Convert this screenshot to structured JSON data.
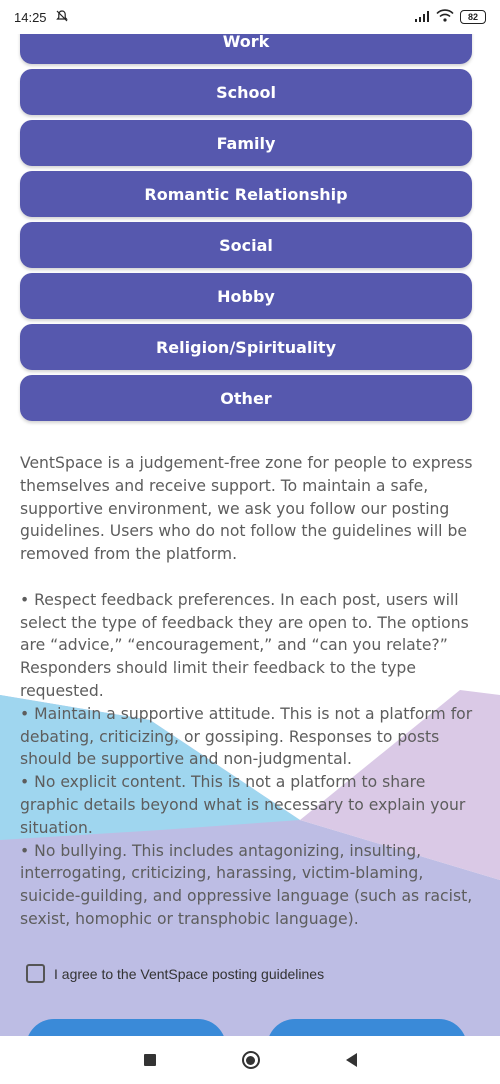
{
  "status_bar": {
    "time": "14:25",
    "battery": "82"
  },
  "categories": [
    "Work",
    "School",
    "Family",
    "Romantic Relationship",
    "Social",
    "Hobby",
    "Religion/Spirituality",
    "Other"
  ],
  "guidelines": {
    "intro": "VentSpace is a judgement-free zone for people to express themselves and receive support. To maintain a safe, supportive environment, we ask you follow our posting guidelines. Users who do not follow the guidelines will be removed from the platform.",
    "rules": [
      "• Respect feedback preferences. In each post, users will select the type of feedback they are open to. The options are “advice,” “encouragement,” and “can you relate?” Responders should limit their feedback to the type requested.",
      "• Maintain a supportive attitude. This is not a platform for debating, criticizing, or gossiping. Responses to posts should be supportive and non-judgmental.",
      "• No explicit content. This is not a platform to share graphic details beyond what is necessary to explain your situation.",
      "• No bullying. This includes antagonizing, insulting, interrogating, criticizing, harassing, victim-blaming, suicide-guilding, and oppressive language (such as racist, sexist, homophic or transphobic language)."
    ]
  },
  "agree": {
    "label": "I agree to the VentSpace posting guidelines"
  },
  "colors": {
    "button": "#5658ae",
    "action_button": "#3a8ad8",
    "blob_blue": "#9fd6ef",
    "blob_purple": "#c6bde6"
  }
}
